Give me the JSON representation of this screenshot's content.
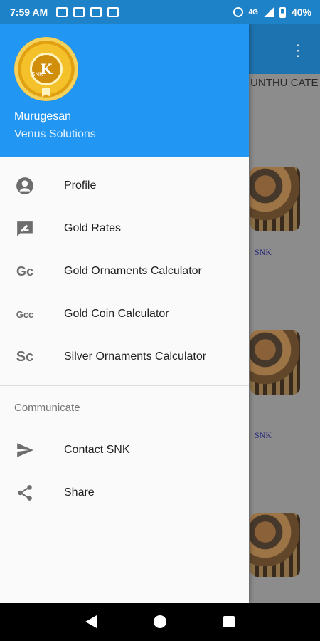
{
  "status": {
    "time": "7:59 AM",
    "network": "4G",
    "battery": "40%"
  },
  "background_app": {
    "category_title": "UNTHU CATE",
    "products": [
      {
        "brand": "SNK"
      },
      {
        "brand": "SNK"
      }
    ]
  },
  "drawer": {
    "user_name": "Murugesan",
    "company": "Venus Solutions",
    "logo_text": "K",
    "logo_small": "SNK",
    "menu": [
      {
        "label": "Profile",
        "icon": "account-circle-icon"
      },
      {
        "label": "Gold Rates",
        "icon": "rate-review-icon"
      },
      {
        "label": "Gold Ornaments Calculator",
        "icon": "gc-text-icon",
        "icon_text": "Gc"
      },
      {
        "label": "Gold Coin Calculator",
        "icon": "gcc-text-icon",
        "icon_text": "Gcc"
      },
      {
        "label": "Silver Ornaments Calculator",
        "icon": "sc-text-icon",
        "icon_text": "Sc"
      }
    ],
    "section_title": "Communicate",
    "communicate": [
      {
        "label": "Contact SNK",
        "icon": "send-icon"
      },
      {
        "label": "Share",
        "icon": "share-icon"
      }
    ]
  },
  "colors": {
    "header": "#2196f3",
    "statusbar": "#1d82c8"
  }
}
